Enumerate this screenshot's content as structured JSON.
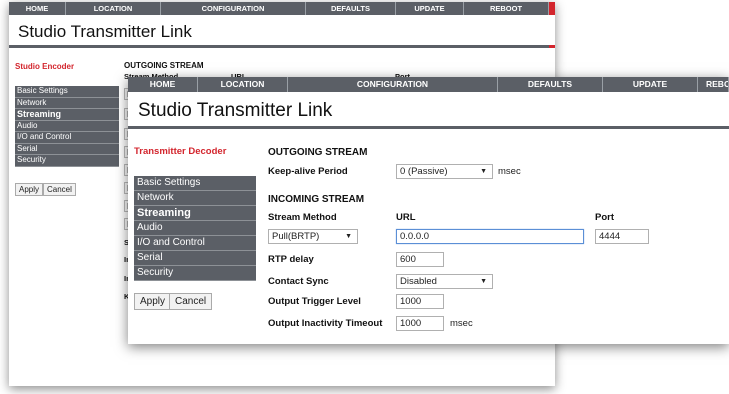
{
  "nav": {
    "tabs": [
      "HOME",
      "LOCATION",
      "CONFIGURATION",
      "DEFAULTS",
      "UPDATE",
      "REBOOT"
    ]
  },
  "back": {
    "title": "Studio Transmitter Link",
    "sidebar_title": "Studio Encoder",
    "menu": [
      "Basic Settings",
      "Network",
      "Streaming",
      "Audio",
      "I/O and Control",
      "Serial",
      "Security"
    ],
    "apply": "Apply",
    "cancel": "Cancel",
    "outgoing_header": "OUTGOING STREAM",
    "stream_method": "Stream Method",
    "url": "URL",
    "port": "Port",
    "partial": [
      "P",
      "M",
      "P",
      "P",
      "P",
      "P",
      "P",
      "P"
    ],
    "partial_labels": [
      "St",
      "In",
      "In",
      "Ke"
    ]
  },
  "front": {
    "title": "Studio Transmitter Link",
    "sidebar_title": "Transmitter Decoder",
    "menu": [
      "Basic Settings",
      "Network",
      "Streaming",
      "Audio",
      "I/O and Control",
      "Serial",
      "Security"
    ],
    "apply": "Apply",
    "cancel": "Cancel",
    "outgoing_header": "OUTGOING STREAM",
    "keep_alive_label": "Keep-alive Period",
    "keep_alive_value": "0 (Passive)",
    "keep_alive_unit": "msec",
    "incoming_header": "INCOMING STREAM",
    "stream_method_label": "Stream Method",
    "url_label": "URL",
    "port_label": "Port",
    "stream_method_value": "Pull(BRTP)",
    "url_value": "0.0.0.0",
    "port_value": "4444",
    "rtp_delay_label": "RTP delay",
    "rtp_delay_value": "600",
    "contact_sync_label": "Contact Sync",
    "contact_sync_value": "Disabled",
    "trigger_label": "Output Trigger Level",
    "trigger_value": "1000",
    "inactivity_label": "Output Inactivity Timeout",
    "inactivity_value": "1000",
    "inactivity_unit": "msec"
  },
  "colors": {
    "nav_bg": "#5b5f66",
    "accent_red": "#d3252d",
    "focus_blue": "#5b8fd6"
  }
}
